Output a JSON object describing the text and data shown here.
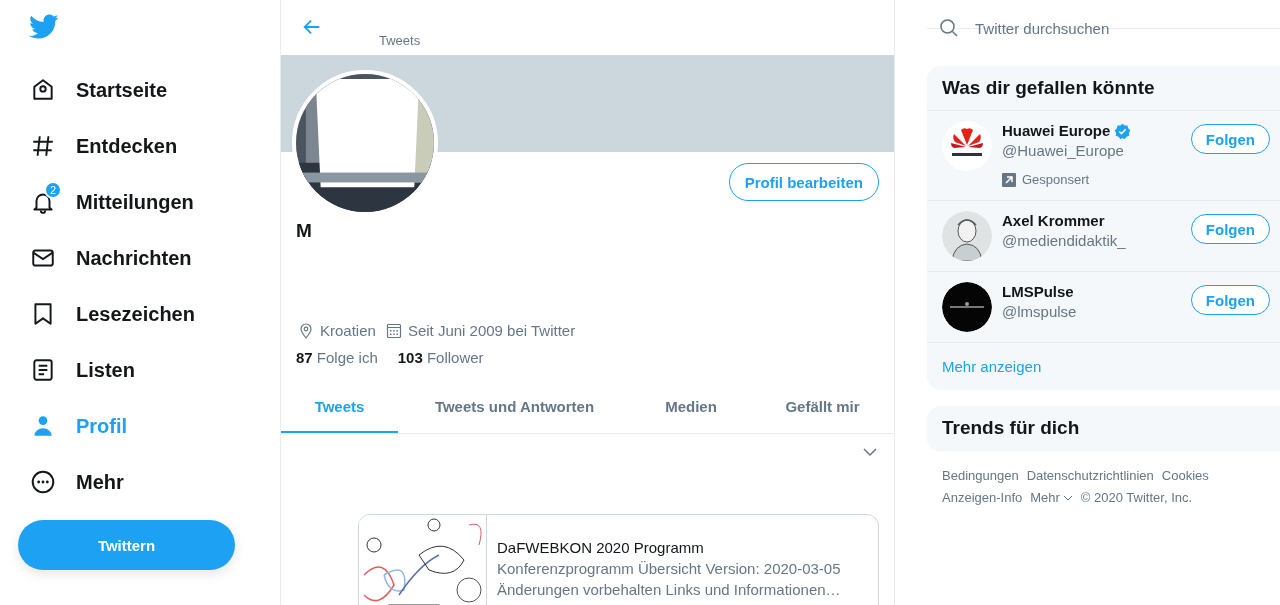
{
  "nav": {
    "items": [
      {
        "label": "Startseite",
        "selected": false
      },
      {
        "label": "Entdecken",
        "selected": false
      },
      {
        "label": "Mitteilungen",
        "selected": false,
        "badge": "2"
      },
      {
        "label": "Nachrichten",
        "selected": false
      },
      {
        "label": "Lesezeichen",
        "selected": false
      },
      {
        "label": "Listen",
        "selected": false
      },
      {
        "label": "Profil",
        "selected": true
      },
      {
        "label": "Mehr",
        "selected": false
      }
    ],
    "tweet_button": "Twittern"
  },
  "profile": {
    "header_subtitle": "Tweets",
    "edit_button": "Profil bearbeiten",
    "name": "M",
    "location": "Kroatien",
    "joined": "Seit Juni 2009 bei Twitter",
    "stats": [
      {
        "count": "87",
        "label": "Folge ich"
      },
      {
        "count": "103",
        "label": "Follower"
      }
    ],
    "tabs": [
      {
        "label": "Tweets",
        "selected": true
      },
      {
        "label": "Tweets und Antworten",
        "selected": false
      },
      {
        "label": "Medien",
        "selected": false
      },
      {
        "label": "Gefällt mir",
        "selected": false
      }
    ],
    "card": {
      "title": "DaFWEBKON 2020 Programm",
      "description": "Konferenzprogramm Übersicht Version: 2020-03-05",
      "description_2": "Änderungen vorbehalten Links und Informationen…"
    }
  },
  "sidebar": {
    "search": {
      "placeholder": "Twitter durchsuchen"
    },
    "suggestions": {
      "title": "Was dir gefallen könnte",
      "accounts": [
        {
          "name": "Huawei Europe",
          "handle": "@Huawei_Europe",
          "verified": true,
          "promoted": "Gesponsert",
          "button": "Folgen",
          "kind": "logo"
        },
        {
          "name": "Axel Krommer",
          "handle": "@mediendidaktik_",
          "verified": false,
          "button": "Folgen",
          "kind": "sketch"
        },
        {
          "name": "LMSPulse",
          "handle": "@lmspulse",
          "verified": false,
          "button": "Folgen",
          "kind": "dark"
        }
      ],
      "more": "Mehr anzeigen"
    },
    "trends_title": "Trends für dich",
    "footer": [
      [
        "Bedingungen",
        "Datenschutzrichtlinien",
        "Cookies"
      ],
      [
        "Anzeigen-Info",
        "Mehr",
        "© 2020 Twitter, Inc."
      ]
    ]
  }
}
